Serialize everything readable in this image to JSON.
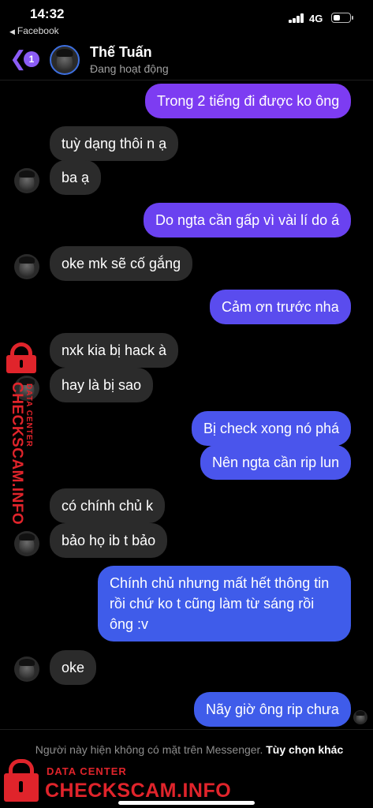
{
  "status_bar": {
    "time": "14:32",
    "back_app": "Facebook",
    "network": "4G"
  },
  "header": {
    "unread_count": "1",
    "contact_name": "Thế Tuấn",
    "contact_status": "Đang hoạt động"
  },
  "messages": [
    {
      "from": "me",
      "text": "Trong 2 tiếng đi được ko ông"
    },
    {
      "from": "contact",
      "text": "tuỳ dạng thôi n ạ"
    },
    {
      "from": "contact",
      "text": "ba ạ"
    },
    {
      "from": "me",
      "text": "Do ngta cần gấp vì vài lí do á"
    },
    {
      "from": "contact",
      "text": "oke mk sẽ cố gắng"
    },
    {
      "from": "me",
      "text": "Cảm ơn trước nha"
    },
    {
      "from": "contact",
      "text": "nxk kia bị hack à"
    },
    {
      "from": "contact",
      "text": "hay là bị sao"
    },
    {
      "from": "me",
      "text": "Bị check xong nó phá"
    },
    {
      "from": "me",
      "text": "Nên ngta cần rip lun"
    },
    {
      "from": "contact",
      "text": "có chính chủ k"
    },
    {
      "from": "contact",
      "text": "bảo họ ib t bảo"
    },
    {
      "from": "me",
      "text": "Chính chủ nhưng mất hết thông tin rồi chứ ko t cũng làm từ sáng rồi ông :v"
    },
    {
      "from": "contact",
      "text": "oke"
    },
    {
      "from": "me",
      "text": "Nãy giờ ông rip chưa"
    }
  ],
  "footer": {
    "notice": "Người này hiện không có mặt trên Messenger.",
    "link": "Tùy chọn khác"
  },
  "watermark": {
    "brand": "CHECKSCAM.INFO",
    "sub": "DATA CENTER"
  },
  "colors": {
    "accent": "#8b5cf6",
    "incoming_bubble": "#2b2b2b",
    "watermark_red": "#e0242b"
  },
  "icons": [
    "chevron-left-icon",
    "signal-icon",
    "battery-icon",
    "lock-icon"
  ]
}
